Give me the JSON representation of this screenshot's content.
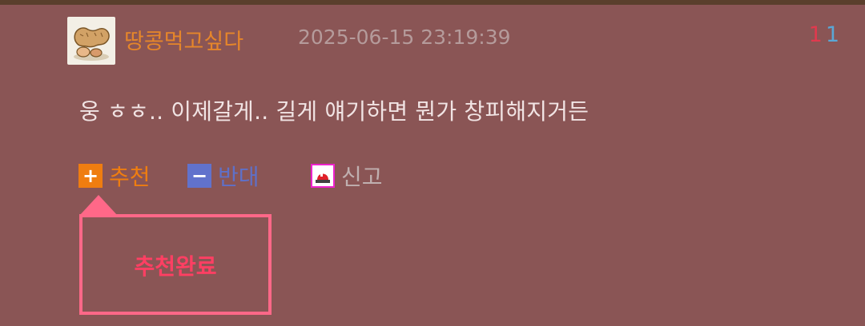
{
  "comment": {
    "author": "땅콩먹고싶다",
    "timestamp": "2025-06-15 23:19:39",
    "upvotes": "1",
    "downvotes": "1",
    "body": "웅 ㅎㅎ.. 이제갈게.. 길게 얘기하면 뭔가 창피해지거든",
    "avatar_icon": "peanut-icon"
  },
  "actions": {
    "recommend_label": "추천",
    "recommend_icon": "plus-icon",
    "oppose_label": "반대",
    "oppose_icon": "minus-icon",
    "report_label": "신고",
    "report_icon": "siren-icon"
  },
  "popup": {
    "message": "추천완료"
  },
  "colors": {
    "background": "#8a5555",
    "author": "#e6862a",
    "recommend": "#ef7d10",
    "oppose": "#6172cc",
    "popup_border": "#ff6888",
    "popup_text": "#ff3f63"
  }
}
